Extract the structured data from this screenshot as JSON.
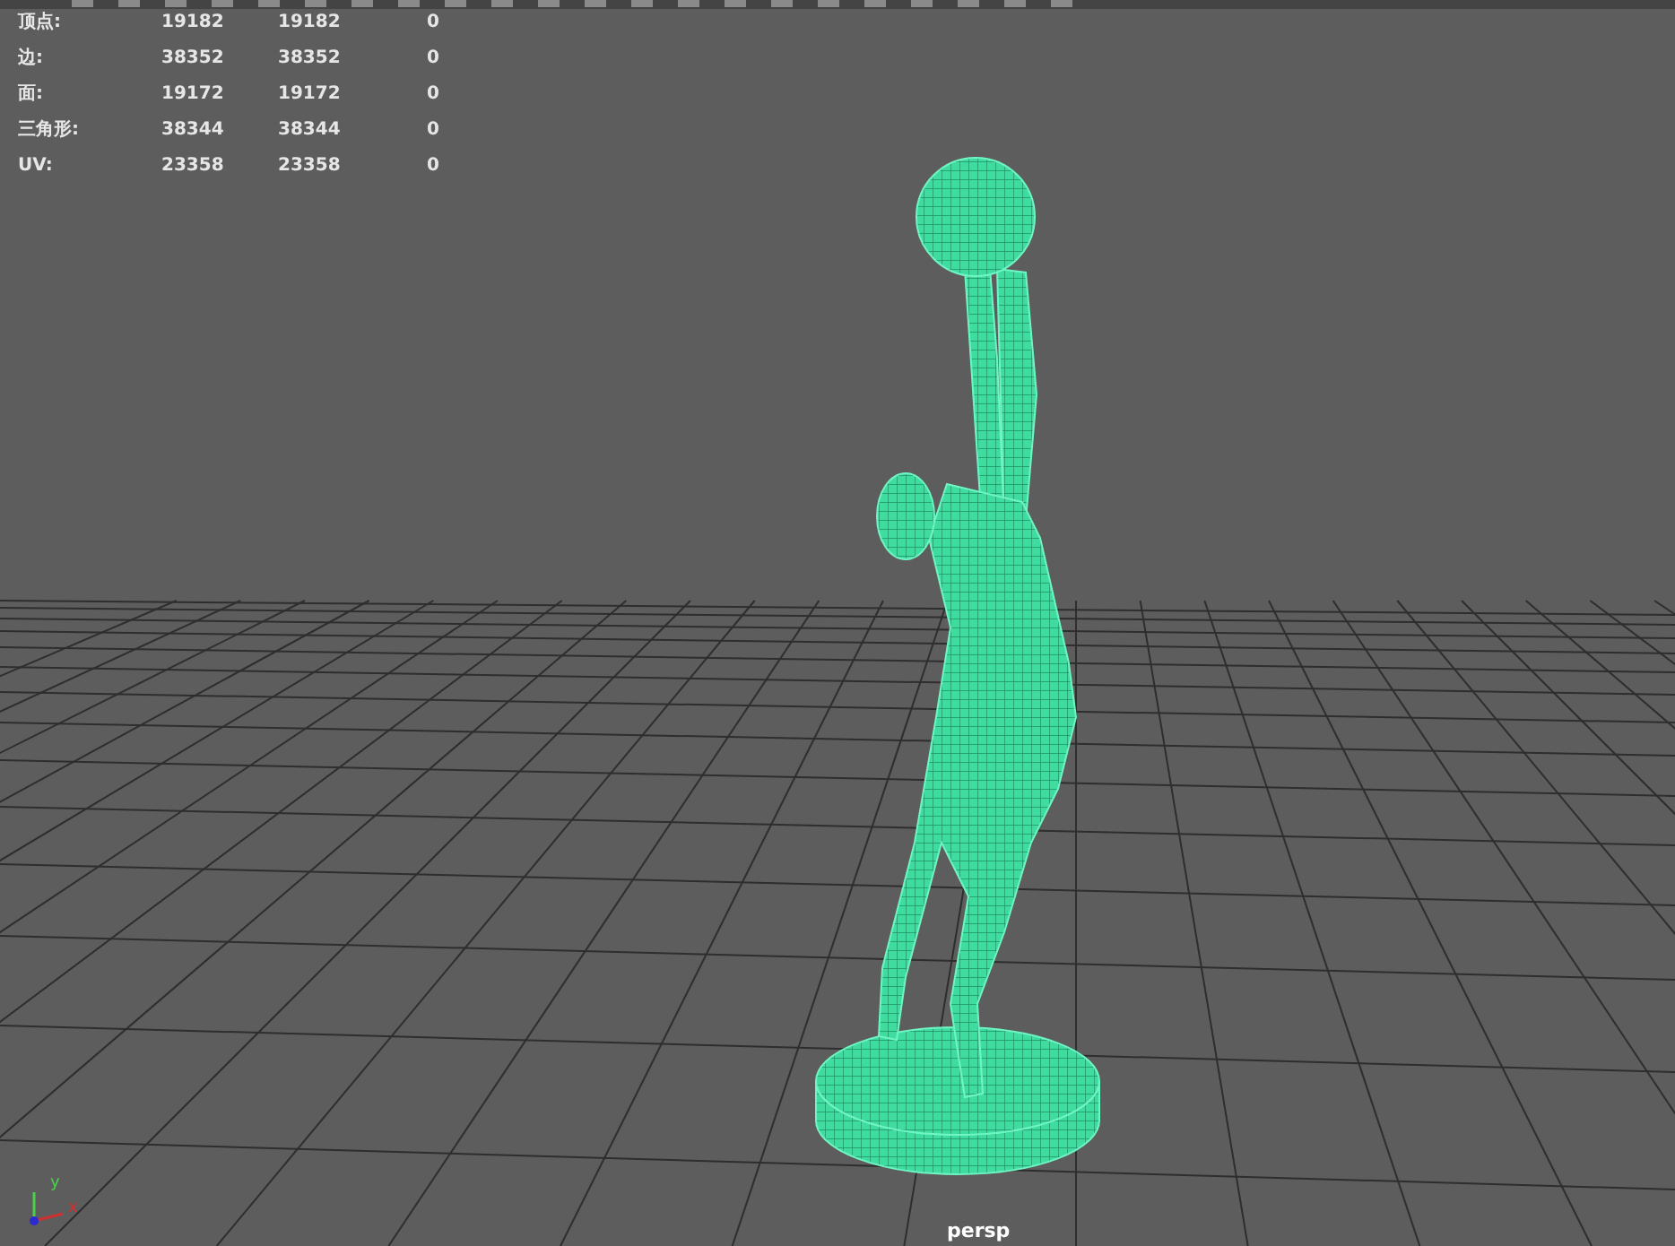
{
  "heads_up_display": {
    "rows": [
      {
        "label": "顶点:",
        "values": [
          "19182",
          "19182",
          "0"
        ]
      },
      {
        "label": "边:",
        "values": [
          "38352",
          "38352",
          "0"
        ]
      },
      {
        "label": "面:",
        "values": [
          "19172",
          "19172",
          "0"
        ]
      },
      {
        "label": "三角形:",
        "values": [
          "38344",
          "38344",
          "0"
        ]
      },
      {
        "label": "UV:",
        "values": [
          "23358",
          "23358",
          "0"
        ]
      }
    ]
  },
  "axis_gizmo": {
    "y_label": "y",
    "x_label": "x"
  },
  "camera_label": "persp"
}
